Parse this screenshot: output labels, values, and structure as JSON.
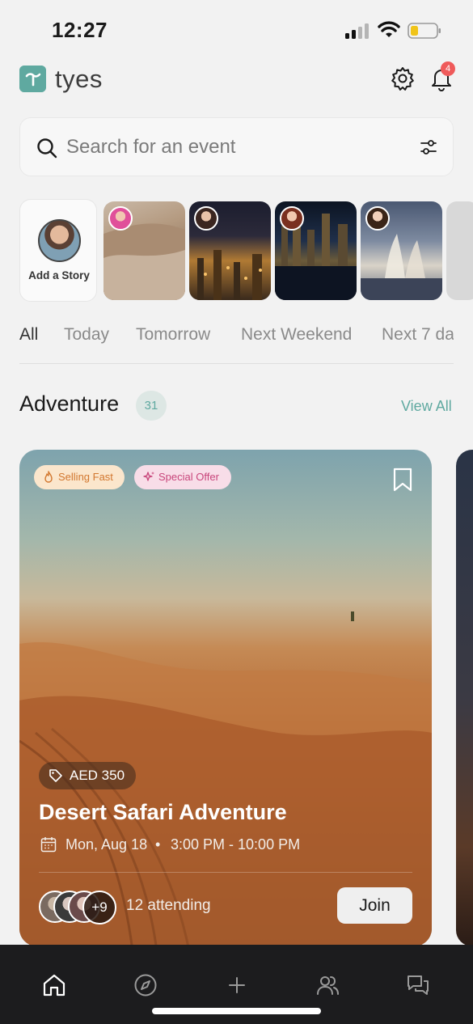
{
  "status_bar": {
    "time": "12:27"
  },
  "header": {
    "app_name": "tyes",
    "notification_count": "4",
    "icons": [
      "settings-icon",
      "bell-icon"
    ]
  },
  "search": {
    "placeholder": "Search for an event"
  },
  "stories": {
    "add_label": "Add a Story",
    "items": [
      "desert-story",
      "city-night-story",
      "marina-night-story",
      "fountain-story"
    ]
  },
  "tabs": [
    "All",
    "Today",
    "Tomorrow",
    "Next Weekend",
    "Next 7 da"
  ],
  "active_tab": "All",
  "section": {
    "title": "Adventure",
    "count": "31",
    "view_all": "View All"
  },
  "event_card": {
    "badges": [
      "Selling Fast",
      "Special Offer"
    ],
    "price": "AED 350",
    "title": "Desert Safari Adventure",
    "date": "Mon, Aug 18",
    "separator": "•",
    "time": "3:00 PM - 10:00 PM",
    "more_attendees": "+9",
    "attending": "12 attending",
    "join_label": "Join"
  },
  "bottom_nav": [
    "home-icon",
    "compass-icon",
    "plus-icon",
    "people-icon",
    "chat-icon"
  ],
  "colors": {
    "accent": "#5fa9a0",
    "badge_red": "#ef5a5a",
    "selling_fast": "#d2772f",
    "special_offer": "#c8467b",
    "nav_bg": "#1c1c1e"
  }
}
